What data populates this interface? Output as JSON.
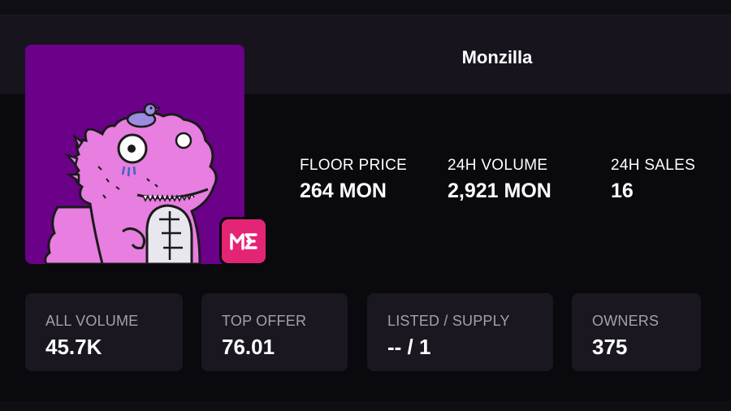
{
  "collection": {
    "name": "Monzilla",
    "artwork_icon": "pink-dinosaur-nft-artwork",
    "marketplace_badge_icon": "magic-eden-logo-icon",
    "colors": {
      "artwork_background": "#6b0089",
      "badge": "#e42575",
      "page_background": "#0a090d",
      "card_background": "#1a1720"
    }
  },
  "stats": {
    "floor_price": {
      "label": "FLOOR PRICE",
      "value": "264 MON"
    },
    "volume_24h": {
      "label": "24H VOLUME",
      "value": "2,921 MON"
    },
    "sales_24h": {
      "label": "24H SALES",
      "value": "16"
    }
  },
  "cards": {
    "all_volume": {
      "label": "ALL VOLUME",
      "value": "45.7K"
    },
    "top_offer": {
      "label": "TOP OFFER",
      "value": "76.01"
    },
    "listed_supply": {
      "label": "LISTED / SUPPLY",
      "value": "-- / 1"
    },
    "owners": {
      "label": "OWNERS",
      "value": "375"
    }
  }
}
